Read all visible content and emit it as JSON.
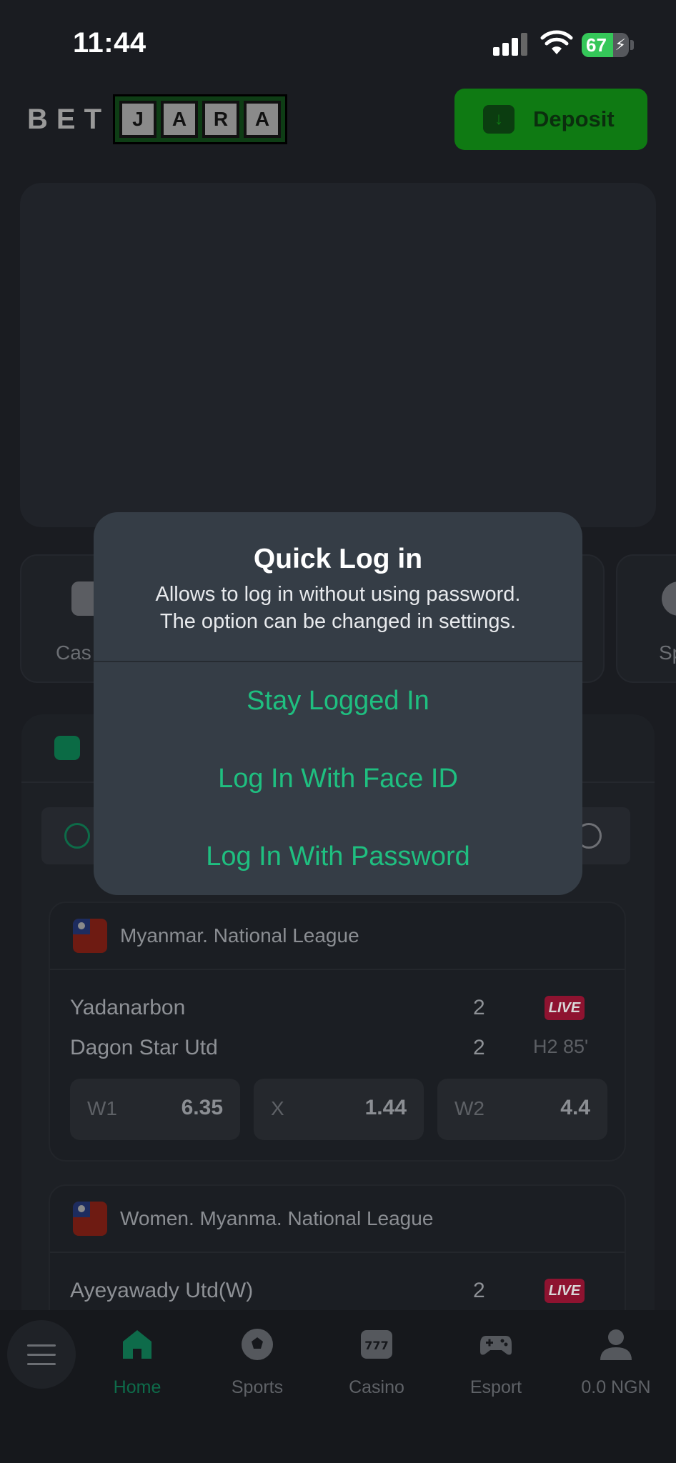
{
  "status_bar": {
    "time": "11:44",
    "battery_percent": 67,
    "battery_label": "67"
  },
  "header": {
    "logo_prefix": "BET",
    "logo_tiles": [
      "J",
      "A",
      "R",
      "A"
    ],
    "deposit_label": "Deposit"
  },
  "categories": [
    {
      "label": "Cas"
    },
    {
      "label": "Sp"
    }
  ],
  "matches": [
    {
      "league": "Myanmar. National League",
      "team1": "Yadanarbon",
      "team2": "Dagon Star Utd",
      "score1": "2",
      "score2": "2",
      "live_badge": "LIVE",
      "time": "H2 85'",
      "odds": [
        {
          "label": "W1",
          "value": "6.35"
        },
        {
          "label": "X",
          "value": "1.44"
        },
        {
          "label": "W2",
          "value": "4.4"
        }
      ]
    },
    {
      "league": "Women. Myanma. National League",
      "team1": "Ayeyawady Utd(W)",
      "score1": "2",
      "live_badge": "LIVE"
    }
  ],
  "bottom_nav": [
    {
      "label": "Home",
      "icon": "home-icon",
      "active": true
    },
    {
      "label": "Sports",
      "icon": "soccer-ball-icon"
    },
    {
      "label": "Casino",
      "icon": "slot-777-icon"
    },
    {
      "label": "Esport",
      "icon": "gamepad-icon"
    },
    {
      "label": "0.0 NGN",
      "icon": "user-icon"
    }
  ],
  "dialog": {
    "title": "Quick Log in",
    "message_line1": "Allows to log in without using password.",
    "message_line2": "The option can be changed in settings.",
    "actions": [
      {
        "label": "Stay Logged In"
      },
      {
        "label": "Log In With Face ID"
      },
      {
        "label": "Log In With Password"
      }
    ]
  },
  "colors": {
    "accent": "#1fbf80",
    "brand_green": "#0f7a13",
    "live_red": "#8e1330",
    "dialog_bg": "#353d46",
    "page_bg": "#1a1c21"
  }
}
